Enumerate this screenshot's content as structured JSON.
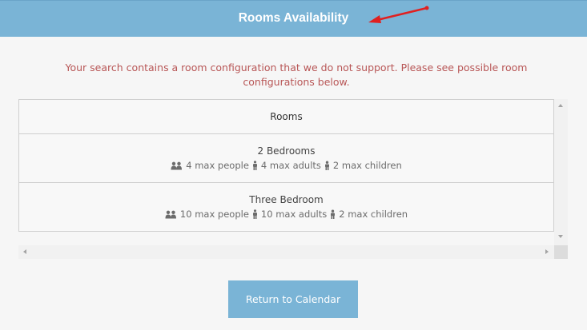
{
  "header": {
    "title": "Rooms Availability"
  },
  "message": "Your search contains a room configuration that we do not support. Please see possible room configurations below.",
  "table": {
    "column_header": "Rooms",
    "rows": [
      {
        "name": "2 Bedrooms",
        "max_people": "4 max people",
        "max_adults": "4 max adults",
        "max_children": "2 max children"
      },
      {
        "name": "Three Bedroom",
        "max_people": "10 max people",
        "max_adults": "10 max adults",
        "max_children": "2 max children"
      }
    ]
  },
  "return_button": "Return to Calendar",
  "colors": {
    "header_bg": "#7ab4d6",
    "error_text": "#b85656",
    "annotation_arrow": "#e02020"
  },
  "icons": {
    "people": "users-icon",
    "adult": "adult-icon",
    "child": "child-icon",
    "annotation": "red-arrow-annotation"
  }
}
